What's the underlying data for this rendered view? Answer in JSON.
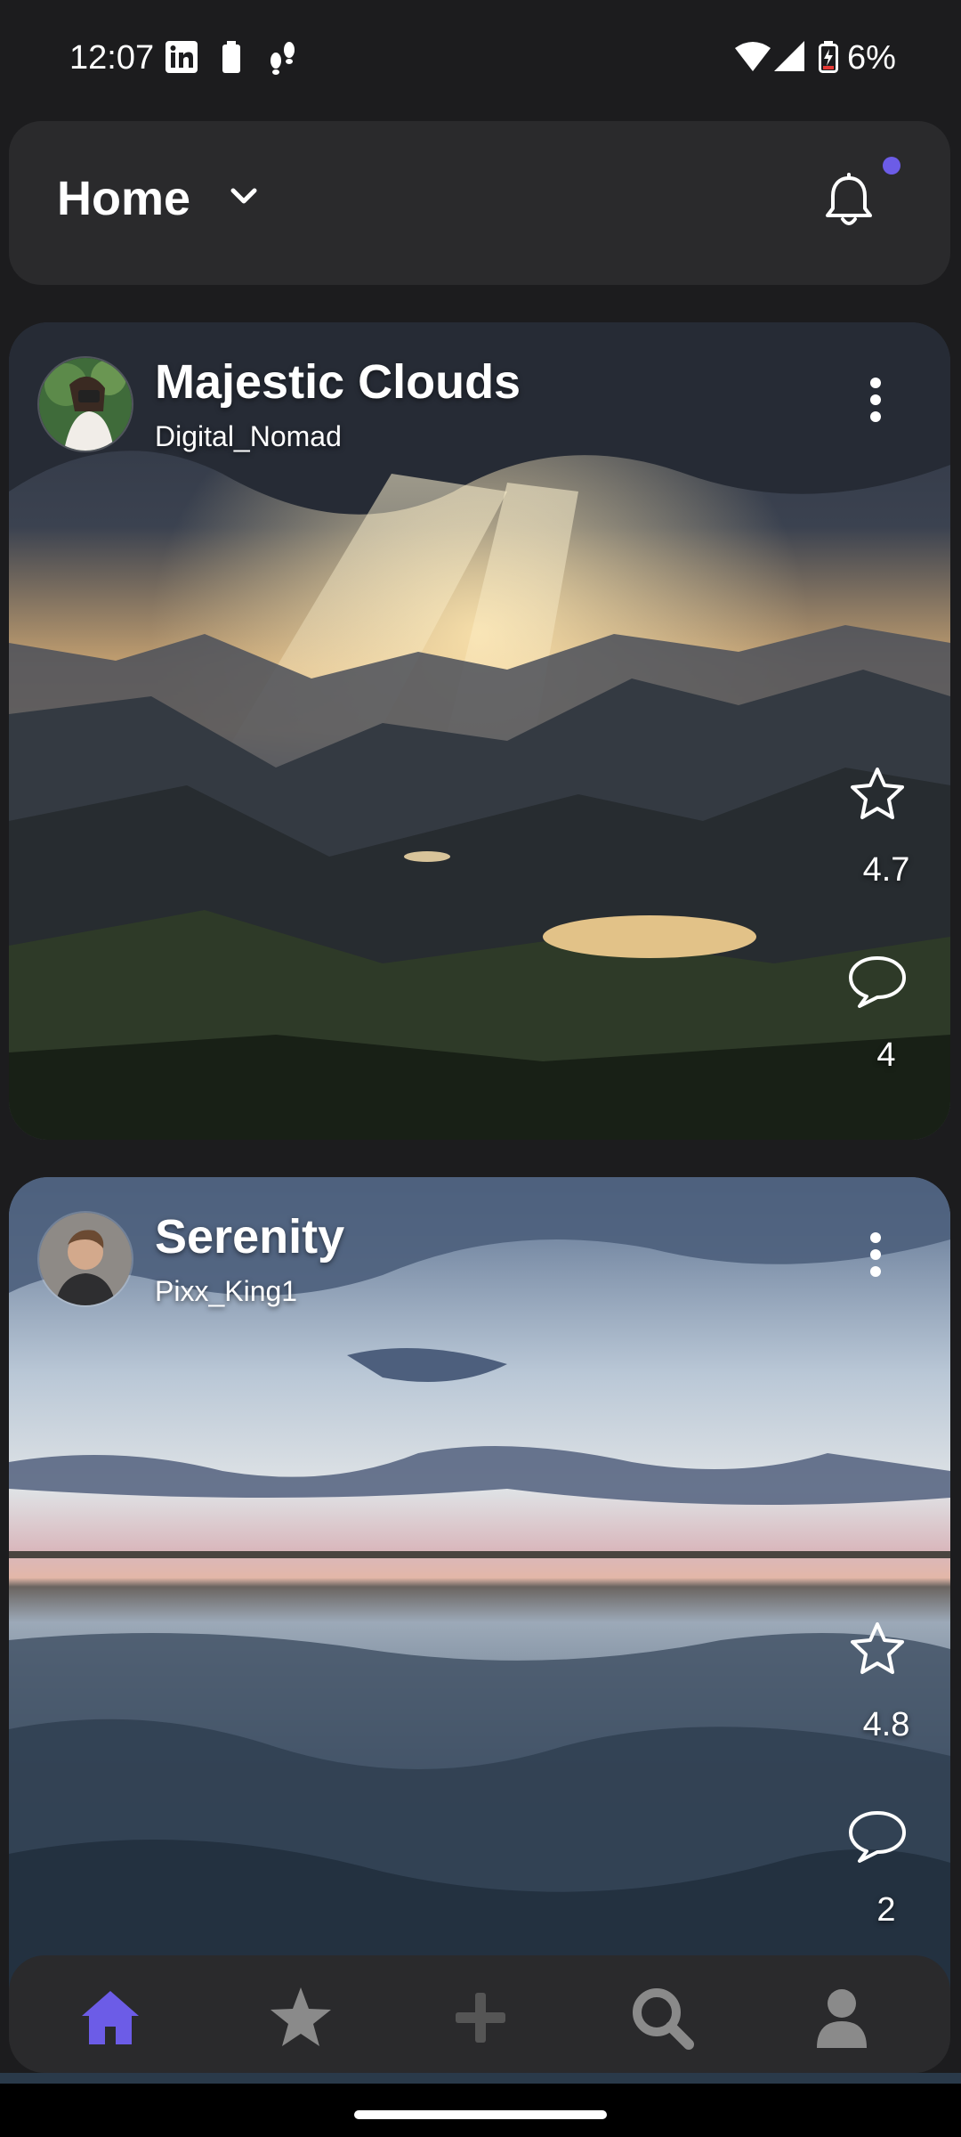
{
  "status_bar": {
    "time": "12:07",
    "battery": "6%",
    "icons": [
      "linkedin-icon",
      "battery-icon",
      "steps-icon",
      "wifi-icon",
      "signal-icon",
      "battery-charging-icon"
    ]
  },
  "header": {
    "title": "Home",
    "notification_dot_color": "#6c5ce7"
  },
  "posts": [
    {
      "title": "Majestic Clouds",
      "author": "Digital_Nomad",
      "rating": "4.7",
      "comments": "4"
    },
    {
      "title": "Serenity",
      "author": "Pixx_King1",
      "rating": "4.8",
      "comments": "2"
    }
  ],
  "nav": {
    "items": [
      "home-icon",
      "star-icon",
      "add-icon",
      "search-icon",
      "profile-icon"
    ],
    "active_color": "#6c5ce7",
    "inactive_color": "#8a8a8a"
  }
}
